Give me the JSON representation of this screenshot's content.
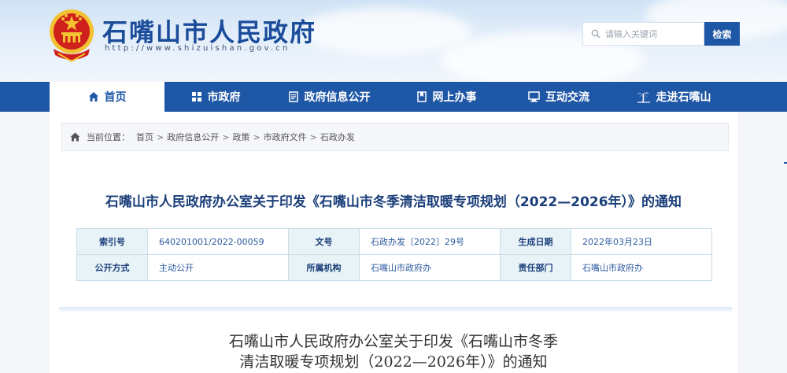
{
  "header": {
    "site_title": "石嘴山市人民政府",
    "site_url": "http://www.shizuishan.gov.cn",
    "search_placeholder": "请输入关键词",
    "search_button": "检索"
  },
  "nav": {
    "items": [
      {
        "label": "首页",
        "icon": "home-icon",
        "active": true
      },
      {
        "label": "市政府",
        "icon": "building-icon",
        "active": false
      },
      {
        "label": "政府信息公开",
        "icon": "document-icon",
        "active": false
      },
      {
        "label": "网上办事",
        "icon": "bookmark-icon",
        "active": false
      },
      {
        "label": "互动交流",
        "icon": "monitor-icon",
        "active": false
      },
      {
        "label": "走进石嘴山",
        "icon": "palm-tree-icon",
        "active": false
      }
    ]
  },
  "breadcrumb": {
    "prefix": "当前位置：",
    "items": [
      "首页",
      "政府信息公开",
      "政策",
      "市政府文件",
      "石政办发"
    ]
  },
  "document": {
    "title": "石嘴山市人民政府办公室关于印发《石嘴山市冬季清洁取暖专项规划（2022—2026年）》的通知",
    "meta": {
      "index_label": "索引号",
      "index_value": "640201001/2022-00059",
      "doc_no_label": "文号",
      "doc_no_value": "石政办发〔2022〕29号",
      "date_label": "生成日期",
      "date_value": "2022年03月23日",
      "disclosure_label": "公开方式",
      "disclosure_value": "主动公开",
      "org_label": "所属机构",
      "org_value": "石嘴山市政府办",
      "dept_label": "责任部门",
      "dept_value": "石嘴山市政府办"
    },
    "article_title_line1": "石嘴山市人民政府办公室关于印发《石嘴山市冬季",
    "article_title_line2": "清洁取暖专项规划（2022—2026年）》的通知"
  },
  "colors": {
    "brand_blue": "#1e57a6",
    "title_blue": "#1b3f7a",
    "emblem_red": "#d0201c",
    "emblem_gold": "#f2c230"
  }
}
